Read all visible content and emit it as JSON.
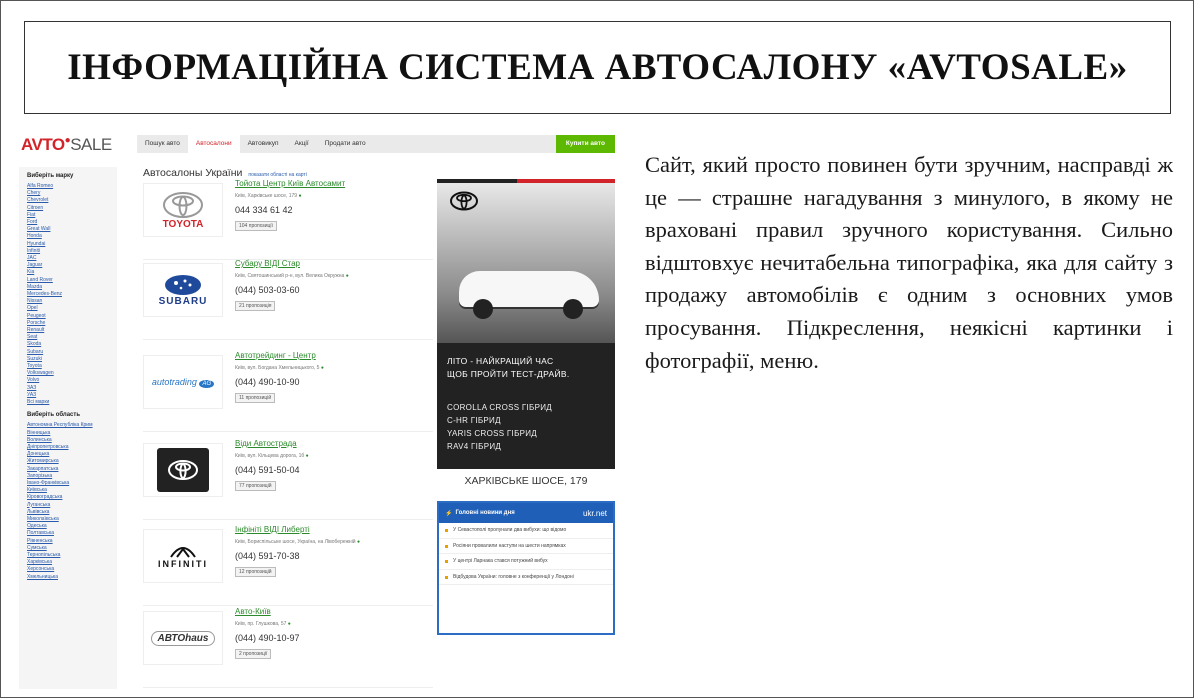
{
  "slide": {
    "title": "ІНФОРМАЦІЙНА СИСТЕМА АВТОСАЛОНУ «AVTOSALE»",
    "text": "Сайт, який просто повинен бути зручним, насправді ж це — страшне нагадування з минулого, в якому не враховані правил зручного користування. Сильно відштовхує нечитабельна типографіка, яка для сайту з продажу автомобілів є одним з основних умов просування. Підкреслення, неякісні картинки і фотографії, меню."
  },
  "site": {
    "logo_a": "AVTO",
    "logo_s": "SALE",
    "nav": [
      "Пошук авто",
      "Автосалони",
      "Автовикуп",
      "Акції",
      "Продати авто"
    ],
    "buy_button": "Купити авто",
    "heading": "Автосалоны України",
    "heading_sub": "показати області на карті",
    "sidebar_heading_1": "Виберіть марку",
    "brands": [
      "Alfa Romeo",
      "Chery",
      "Chevrolet",
      "Citroen",
      "Fiat",
      "Ford",
      "Great Wall",
      "Honda",
      "Hyundai",
      "Infiniti",
      "JAC",
      "Jaguar",
      "Kia",
      "Land Rover",
      "Mazda",
      "Mercedes-Benz",
      "Nissan",
      "Opel",
      "Peugeot",
      "Porsche",
      "Renault",
      "Seat",
      "Skoda",
      "Subaru",
      "Suzuki",
      "Toyota",
      "Volkswagen",
      "Volvo",
      "ЗАЗ",
      "УАЗ",
      "Всі марки"
    ],
    "sidebar_heading_2": "Виберіть область",
    "regions": [
      "Автономна Республіка Крим",
      "Вінницька",
      "Волинська",
      "Дніпропетровська",
      "Донецька",
      "Житомирська",
      "Закарпатська",
      "Запорізька",
      "Івано-Франківська",
      "Київська",
      "Кіровоградська",
      "Луганська",
      "Львівська",
      "Миколаївська",
      "Одеська",
      "Полтавська",
      "Рівненська",
      "Сумська",
      "Тернопільська",
      "Харківська",
      "Херсонська",
      "Хмельницька"
    ],
    "dealers": [
      {
        "logo": "TOYOTA",
        "name": "Тойота Центр Київ Автосамит",
        "address": "Київ, Харківське шосе, 179",
        "phone": "044 334 61 42",
        "count": "104 пропозиції"
      },
      {
        "logo": "SUBARU",
        "name": "Субару ВІДІ Стар",
        "address": "Київ, Святошинський р-н, вул. Велика Окружна",
        "phone": "(044) 503-03-60",
        "count": "21 пропозиція"
      },
      {
        "logo": "autotrading",
        "name": "Автотрейдинг - Центр",
        "address": "Київ, вул. Богдана Хмельницького, 5",
        "phone": "(044) 490-10-90",
        "count": "11 пропозицій"
      },
      {
        "logo": "TOYOTA",
        "name": "Віди Автострада",
        "address": "Київ, вул. Кільцева дорога, 1б",
        "phone": "(044) 591-50-04",
        "count": "77 пропозицій"
      },
      {
        "logo": "INFINITI",
        "name": "Інфініті ВІДІ Либерті",
        "address": "Київ, Бориспільське шосе, Україна, на Лівобережній",
        "phone": "(044) 591-70-38",
        "count": "12 пропозицій"
      },
      {
        "logo": "AUTOHAUS",
        "name": "Авто-Київ",
        "address": "Київ, пр. Глушкова, 57",
        "phone": "(044) 490-10-97",
        "count": "2 пропозиції"
      }
    ],
    "ad": {
      "tagline_1": "ЛІТО - НАЙКРАЩИЙ ЧАС",
      "tagline_2": "ЩОБ ПРОЙТИ ТЕСТ-ДРАЙВ.",
      "models": [
        "COROLLA CROSS ГІБРИД",
        "C-HR ГІБРИД",
        "YARIS CROSS ГІБРИД",
        "RAV4 ГІБРИД"
      ],
      "address": "ХАРКІВСЬКЕ ШОСЕ, 179"
    },
    "news": {
      "header": "Головні новини дня",
      "source": "ukr.net",
      "items": [
        "У Севастополі пролунали два вибухи: що відомо",
        "Росіяни провалили наступи на шести напрямках",
        "У центрі Ларнака стався потужний вибух",
        "Відбудова України: головне з конференції у Лондоні"
      ]
    }
  },
  "colors": {
    "red": "#d2232a",
    "green": "#5cb800",
    "link": "#2b5bab"
  }
}
